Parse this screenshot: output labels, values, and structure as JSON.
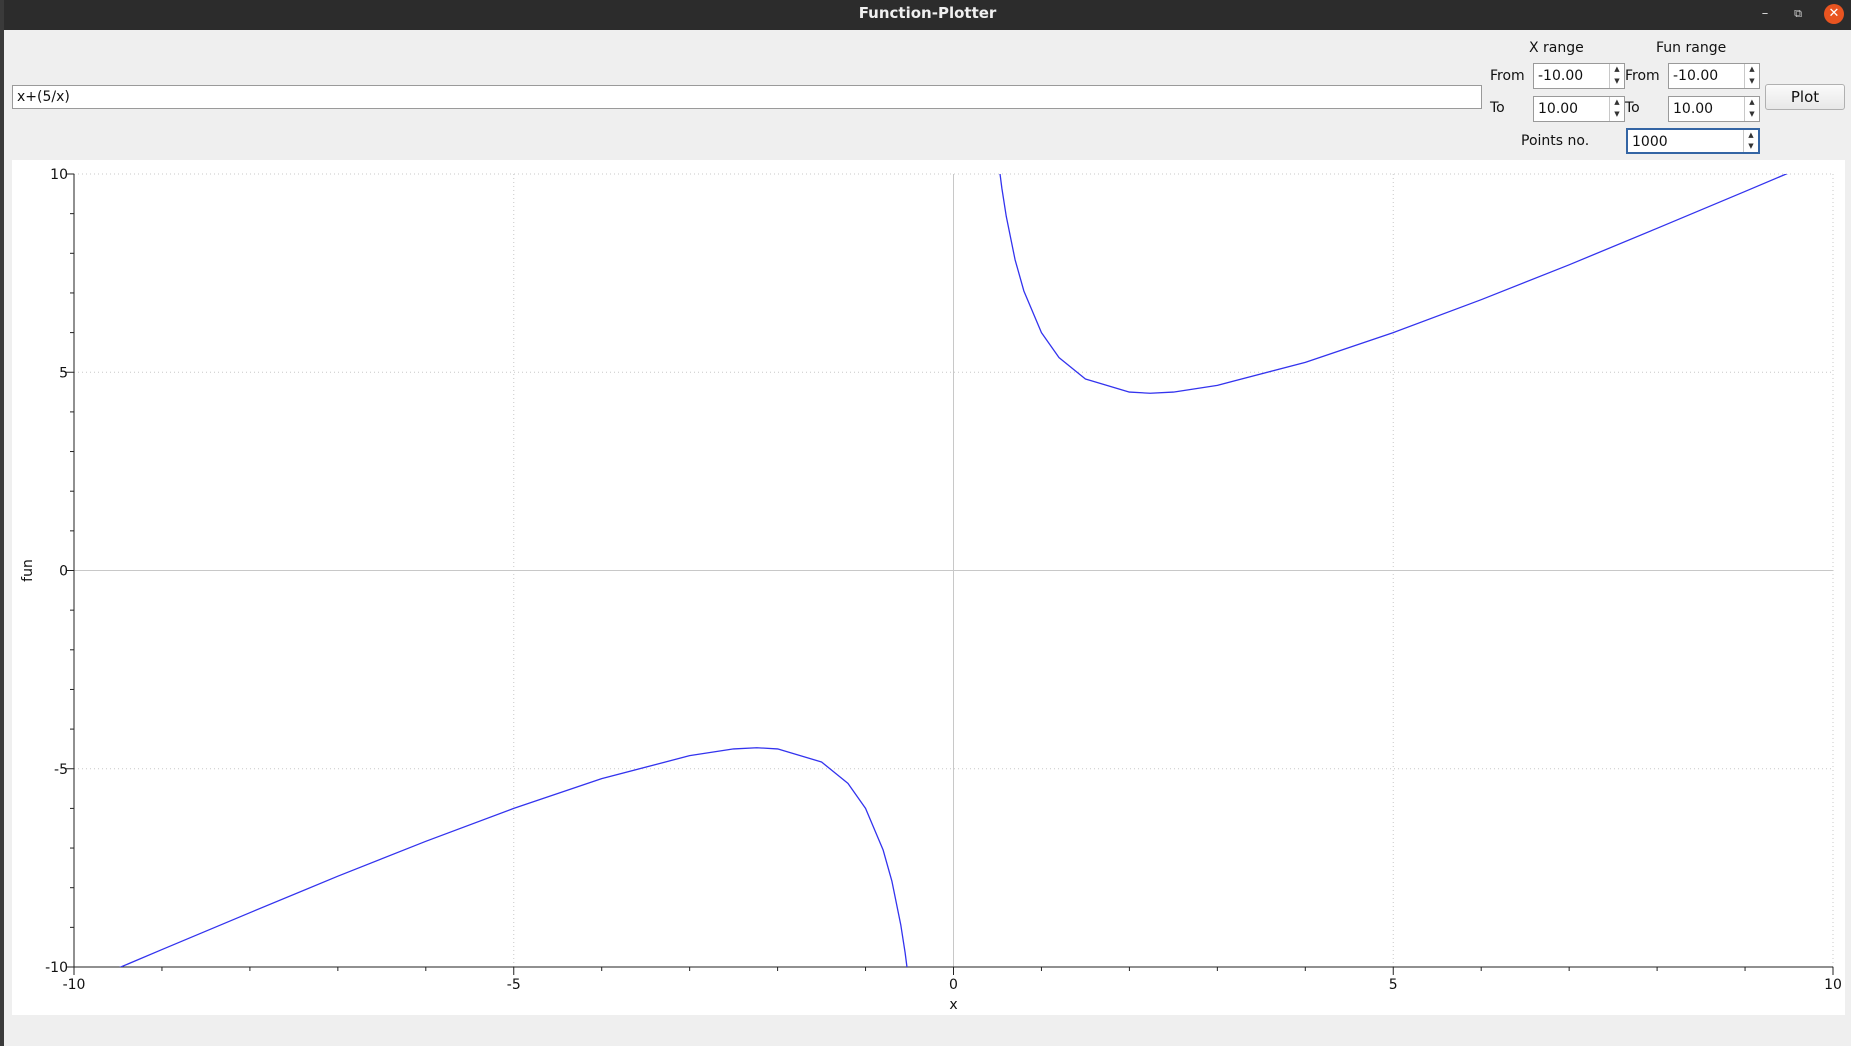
{
  "window": {
    "title": "Function-Plotter"
  },
  "controls": {
    "expression": "x+(5/x)",
    "x_range_label": "X range",
    "fun_range_label": "Fun range",
    "from_label": "From",
    "to_label": "To",
    "points_label": "Points no.",
    "x_from": "-10.00",
    "x_to": "10.00",
    "fun_from": "-10.00",
    "fun_to": "10.00",
    "points": "1000",
    "plot_button": "Plot"
  },
  "colors": {
    "curve": "#3333ee",
    "close_button": "#e95420",
    "focus": "#3465a4"
  },
  "icons": {
    "minimize": "minimize-icon",
    "maximize": "maximize-icon",
    "close": "close-icon"
  },
  "chart_data": {
    "type": "line",
    "expression": "x+(5/x)",
    "xlabel": "x",
    "ylabel": "fun",
    "xlim": [
      -10,
      10
    ],
    "ylim": [
      -10,
      10
    ],
    "x_ticks": [
      -10,
      -5,
      0,
      5,
      10
    ],
    "y_ticks": [
      -10,
      -5,
      0,
      5,
      10
    ],
    "x_tick_labels": [
      "-10",
      "-5",
      "0",
      "5",
      "10"
    ],
    "y_tick_labels": [
      "-10",
      "-5",
      "0",
      "5",
      "10"
    ],
    "grid": true,
    "series": [
      {
        "x": [
          -9.5,
          -9,
          -8,
          -7,
          -6,
          -5,
          -4,
          -3,
          -2.5,
          -2.236,
          -2,
          -1.5,
          -1.2,
          -1,
          -0.8,
          -0.7,
          -0.6,
          -0.55,
          -0.5
        ],
        "y": [
          -10.03,
          -9.56,
          -8.63,
          -7.71,
          -6.83,
          -6.0,
          -5.25,
          -4.67,
          -4.5,
          -4.47,
          -4.5,
          -4.83,
          -5.37,
          -6.0,
          -7.05,
          -7.84,
          -8.93,
          -9.64,
          -10.5
        ]
      },
      {
        "x": [
          0.5,
          0.55,
          0.6,
          0.7,
          0.8,
          1,
          1.2,
          1.5,
          2,
          2.236,
          2.5,
          3,
          4,
          5,
          6,
          7,
          8,
          9,
          9.5
        ],
        "y": [
          10.5,
          9.64,
          8.93,
          7.84,
          7.05,
          6.0,
          5.37,
          4.83,
          4.5,
          4.47,
          4.5,
          4.67,
          5.25,
          6.0,
          6.83,
          7.71,
          8.63,
          9.56,
          10.03
        ]
      }
    ]
  }
}
